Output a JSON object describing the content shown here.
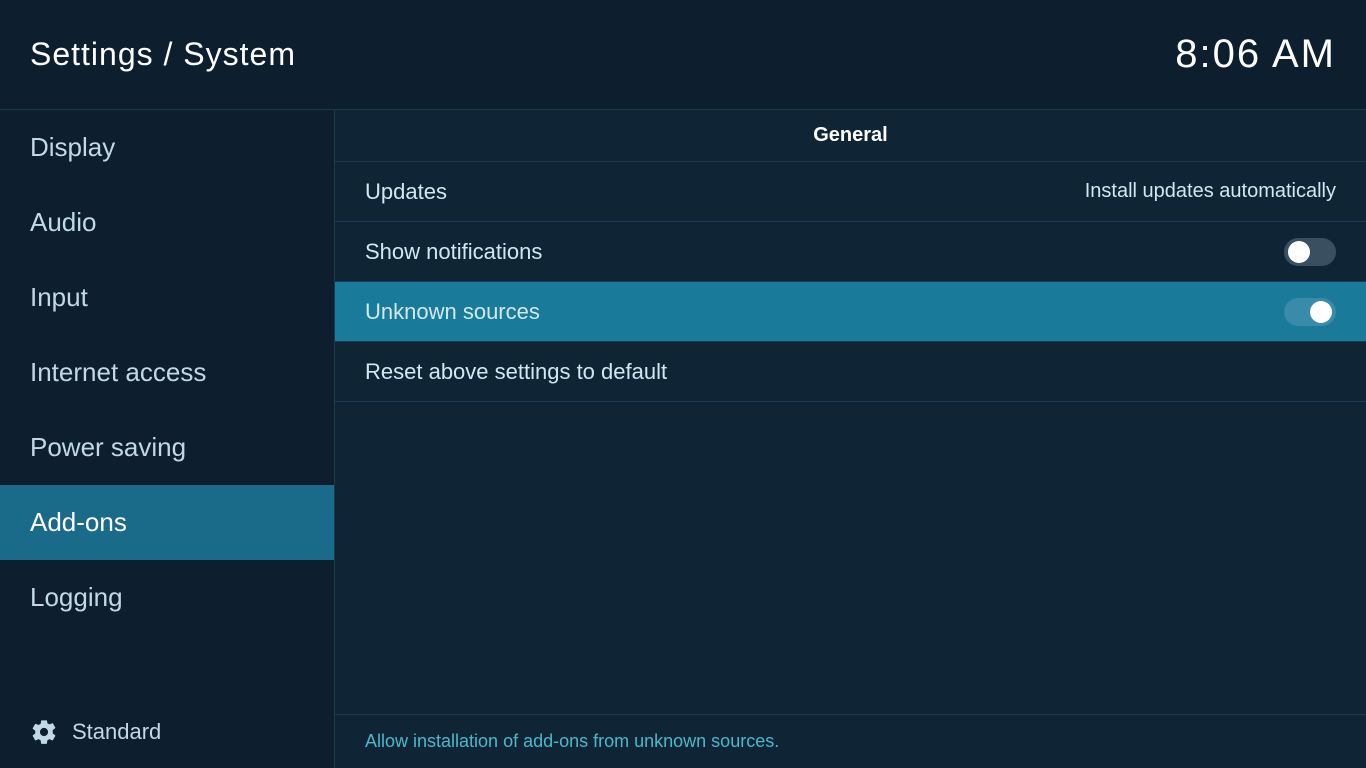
{
  "header": {
    "title": "Settings / System",
    "clock": "8:06 AM"
  },
  "sidebar": {
    "items": [
      {
        "id": "display",
        "label": "Display",
        "active": false
      },
      {
        "id": "audio",
        "label": "Audio",
        "active": false
      },
      {
        "id": "input",
        "label": "Input",
        "active": false
      },
      {
        "id": "internet-access",
        "label": "Internet access",
        "active": false
      },
      {
        "id": "power-saving",
        "label": "Power saving",
        "active": false
      },
      {
        "id": "add-ons",
        "label": "Add-ons",
        "active": true
      },
      {
        "id": "logging",
        "label": "Logging",
        "active": false
      }
    ],
    "footer": {
      "level_label": "Standard"
    }
  },
  "content": {
    "section_header": "General",
    "rows": [
      {
        "id": "updates",
        "label": "Updates",
        "value": "Install updates automatically",
        "toggle": null,
        "highlighted": false
      },
      {
        "id": "show-notifications",
        "label": "Show notifications",
        "value": null,
        "toggle": "off",
        "highlighted": false
      },
      {
        "id": "unknown-sources",
        "label": "Unknown sources",
        "value": null,
        "toggle": "on",
        "highlighted": true
      },
      {
        "id": "reset-above",
        "label": "Reset above settings to default",
        "value": null,
        "toggle": null,
        "highlighted": false
      }
    ],
    "footer_description": "Allow installation of add-ons from unknown sources."
  }
}
